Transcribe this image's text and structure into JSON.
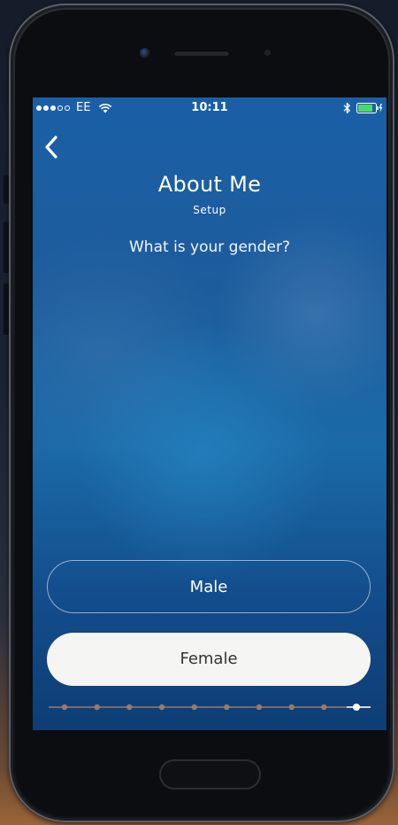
{
  "status_bar": {
    "signal_filled": 3,
    "signal_total": 5,
    "carrier": "EE",
    "time": "10:11",
    "battery_level": 0.85,
    "charging": true
  },
  "header": {
    "title": "About Me",
    "subtitle": "Setup"
  },
  "question": "What is your gender?",
  "options": [
    {
      "label": "Male",
      "selected": false
    },
    {
      "label": "Female",
      "selected": true
    }
  ],
  "progress": {
    "total_steps": 10,
    "current_step": 10
  },
  "colors": {
    "accent_white": "#ffffff",
    "progress_dot": "#9a7a6a",
    "selected_fill": "#f5f5f3"
  }
}
